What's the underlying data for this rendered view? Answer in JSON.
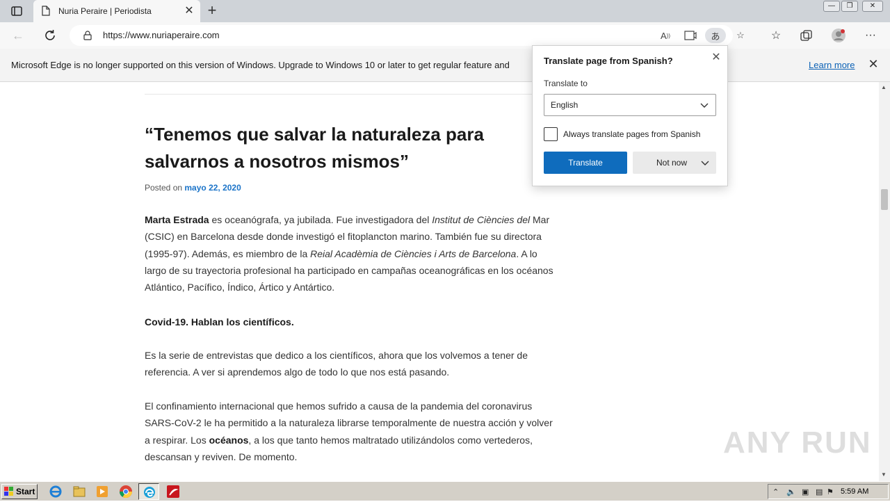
{
  "browser": {
    "tab": {
      "title": "Nuria Peraire | Periodista"
    },
    "address": {
      "url": "https://www.nuriaperaire.com"
    }
  },
  "infobar": {
    "message": "Microsoft Edge is no longer supported on this version of Windows. Upgrade to Windows 10 or later to get regular feature and",
    "link": "Learn more"
  },
  "article": {
    "title_line1": "“Tenemos que salvar la naturaleza para",
    "title_line2": "salvarnos a nosotros mismos”",
    "posted_prefix": "Posted on",
    "posted_date": "mayo 22, 2020",
    "p1": {
      "name": "Marta Estrada",
      "t1": " es oceanógrafa, ya jubilada. Fue investigadora del ",
      "inst": "Institut de Ciències del",
      "t2": " Mar (CSIC) en Barcelona desde donde investigó el fitoplancton marino. También fue su directora (1995-97). Además, es miembro de la ",
      "academy": "Reial Acadèmia de Ciències i Arts de Barcelona",
      "t3": ". A lo largo de su trayectoria profesional ha participado en campañas oceanográficas en los océanos Atlántico, Pacífico, Índico, Ártico y Antártico."
    },
    "p2": "Covid-19. Hablan los científicos.",
    "p3": "Es la serie de entrevistas que dedico a los científicos, ahora que los volvemos a tener de referencia. A ver si aprendemos algo de todo lo que nos está pasando.",
    "p4": {
      "t1": "El confinamiento internacional que hemos sufrido a causa de la pandemia del coronavirus SARS-CoV-2 le ha permitido a la naturaleza librarse temporalmente de nuestra acción y volver a respirar. Los ",
      "bold": "océanos",
      "t2": ", a los que tanto hemos maltratado utilizándolos como vertederos, descansan y reviven. De momento."
    }
  },
  "translate_popup": {
    "title": "Translate page from Spanish?",
    "translate_to_label": "Translate to",
    "selected_language": "English",
    "always_label": "Always translate pages from Spanish",
    "always_checked": false,
    "translate_button": "Translate",
    "not_now_button": "Not now"
  },
  "taskbar": {
    "start_label": "Start",
    "clock": "5:59 AM"
  },
  "watermark": "ANY RUN",
  "colors": {
    "accent": "#0f6cbd",
    "link": "#1a73c8"
  }
}
